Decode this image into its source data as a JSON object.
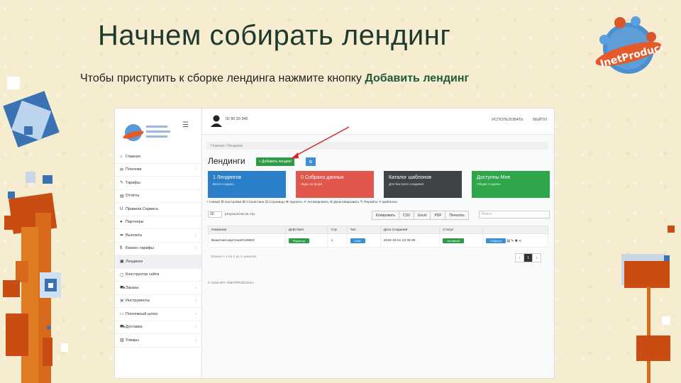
{
  "slide": {
    "title": "Начнем собирать лендинг",
    "subtitle_prefix": "Чтобы приступить к сборке лендинга нажмите кнопку ",
    "subtitle_highlight": "Добавить лендинг",
    "logo_text": "Inet Produce"
  },
  "app": {
    "topbar": {
      "user": "ID 90 30 345",
      "links": [
        "ИСПОЛЬЗОВАТЬ",
        "ВЫЙТИ"
      ]
    },
    "sidebar": {
      "items": [
        {
          "icon": "home-icon",
          "glyph": "⌂",
          "label": "Главная",
          "chev": ""
        },
        {
          "icon": "envelope-icon",
          "glyph": "✉",
          "label": "Платежи",
          "chev": "‹"
        },
        {
          "icon": "wrench-icon",
          "glyph": "✎",
          "label": "Тарифы",
          "chev": ""
        },
        {
          "icon": "list-icon",
          "glyph": "▤",
          "label": "Отчёты",
          "chev": ""
        },
        {
          "icon": "magnet-icon",
          "glyph": "U",
          "label": "Правила Сервиса",
          "chev": ""
        },
        {
          "icon": "users-icon",
          "glyph": "●",
          "label": "Партнеры",
          "chev": ""
        },
        {
          "icon": "share-icon",
          "glyph": "➦",
          "label": "Выплаты",
          "chev": "‹"
        },
        {
          "icon": "dollar-icon",
          "glyph": "$",
          "label": "Бизнес-тарифы",
          "chev": "‹"
        },
        {
          "icon": "file-icon",
          "glyph": "▣",
          "label": "Лендинги",
          "chev": ""
        },
        {
          "icon": "page-icon",
          "glyph": "▢",
          "label": "Конструктор сайта",
          "chev": ""
        },
        {
          "icon": "cart-icon",
          "glyph": "⛟",
          "label": "Заказы",
          "chev": "‹"
        },
        {
          "icon": "tools-icon",
          "glyph": "⚒",
          "label": "Инструменты",
          "chev": "‹"
        },
        {
          "icon": "tag-icon",
          "glyph": "▭",
          "label": "Платежный шлюз",
          "chev": "‹"
        },
        {
          "icon": "truck-icon",
          "glyph": "⛟",
          "label": "Доставка",
          "chev": "‹"
        },
        {
          "icon": "doc-icon",
          "glyph": "▥",
          "label": "Товары",
          "chev": "‹"
        }
      ]
    },
    "breadcrumb": "Главная / Лендинги",
    "page_title": "Лендинги",
    "add_button": "+ Добавить лендинг",
    "gear_glyph": "⚙",
    "cards": [
      {
        "title": "1 Лендингов",
        "sub": "Всего создано",
        "color": "#2b7fc9"
      },
      {
        "title": "0 Собрано данных",
        "sub": "Лиды из форм",
        "color": "#e1574d"
      },
      {
        "title": "Каталог шаблонов",
        "sub": "Для быстрого создания",
        "color": "#3f4247"
      },
      {
        "title": "Доступны Мне",
        "sub": "Общие созданы",
        "color": "#2fa64a"
      }
    ],
    "toolbar_actions": "+ Новый   ⚙ Настройки   ⊞ Статистика   ⊟ Страницы   ⊕ Удалить   ✔ Активировать   ⊘ Деактивировать   ✎ Перейти   ≺ Шаблоны",
    "table_controls": {
      "per_page": "10",
      "per_page_label": "результатов на стр.",
      "export": [
        "Копировать",
        "CSV",
        "Excel",
        "PDF",
        "Печатать"
      ],
      "search_placeholder": "Поиск:"
    },
    "table": {
      "headers": [
        "Название",
        "Действия",
        "Стр",
        "Тип",
        "Дата Создания",
        "Статус",
        ""
      ],
      "rows": [
        {
          "name": "Визитная-карточка#125863",
          "action": "Редактор",
          "pages": "1",
          "type": "Сайт",
          "date": "2018-10-01 23:35:29",
          "status": "Активный",
          "open": "Открыть"
        }
      ]
    },
    "showing": "Записи с 1 по 1 из 1 записей",
    "pager": [
      "‹",
      "1",
      "›"
    ],
    "footer": "© 2018 ИП «INETPRODUCE»"
  }
}
